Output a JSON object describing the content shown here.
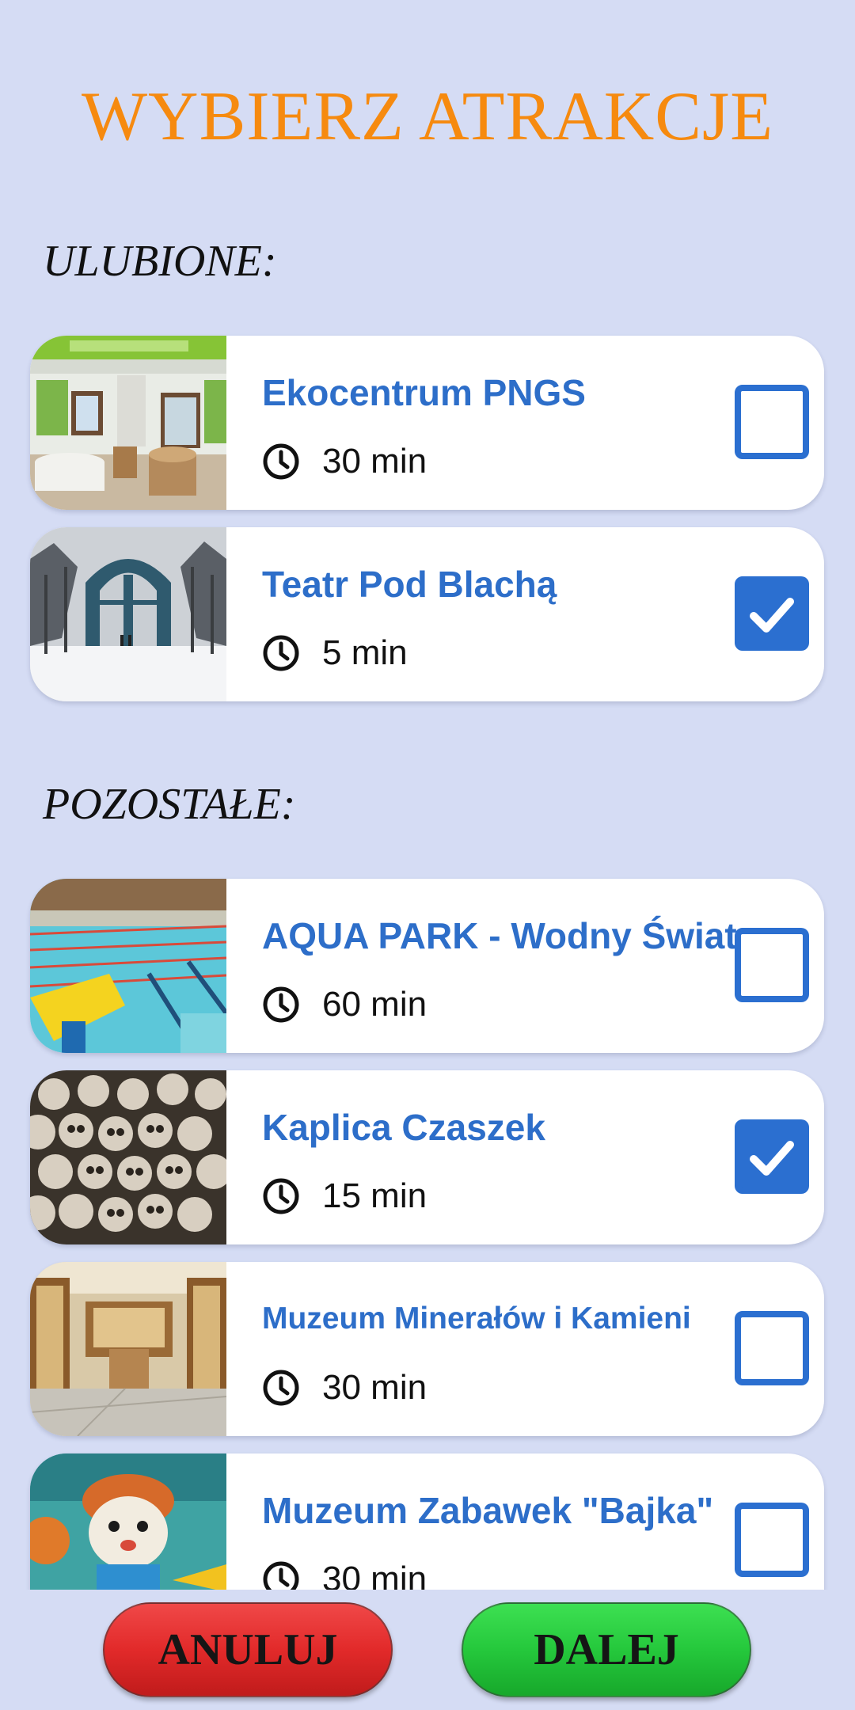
{
  "header": {
    "title": "WYBIERZ ATRAKCJE"
  },
  "sections": {
    "favorites_label": "ULUBIONE:",
    "others_label": "POZOSTAŁE:"
  },
  "favorites": [
    {
      "name": "Ekocentrum PNGS",
      "time": "30 min",
      "checked": false
    },
    {
      "name": "Teatr Pod Blachą",
      "time": "5 min",
      "checked": true
    }
  ],
  "others": [
    {
      "name": "AQUA PARK - Wodny Świat",
      "time": "60 min",
      "checked": false
    },
    {
      "name": "Kaplica Czaszek",
      "time": "15 min",
      "checked": true
    },
    {
      "name": "Muzeum Minerałów i Kamieni",
      "time": "30 min",
      "checked": false
    },
    {
      "name": "Muzeum Zabawek \"Bajka\"",
      "time": "30 min",
      "checked": false
    }
  ],
  "buttons": {
    "cancel": "ANULUJ",
    "next": "DALEJ"
  },
  "colors": {
    "background": "#d5dcf4",
    "title": "#f68a0f",
    "accent": "#2b6fd0",
    "cancel": "#e22a2a",
    "next": "#25c83c"
  },
  "icons": {
    "time": "clock-icon",
    "checked": "checkmark-icon"
  }
}
